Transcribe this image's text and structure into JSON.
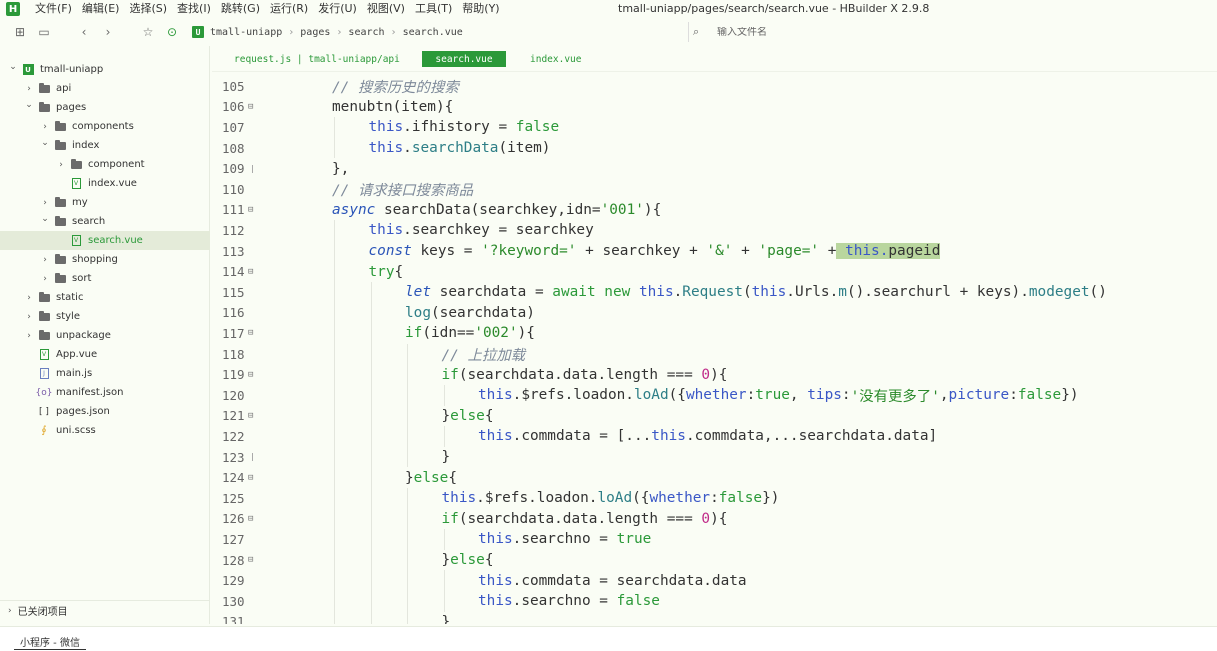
{
  "app": {
    "logo": "H",
    "window_title": "tmall-uniapp/pages/search/search.vue - HBuilder X 2.9.8",
    "menu": [
      "文件(F)",
      "编辑(E)",
      "选择(S)",
      "查找(I)",
      "跳转(G)",
      "运行(R)",
      "发行(U)",
      "视图(V)",
      "工具(T)",
      "帮助(Y)"
    ]
  },
  "toolbar": {
    "icons": [
      "new-file-icon",
      "save-icon",
      "back-icon",
      "forward-icon",
      "bookmark-star-icon",
      "run-icon"
    ],
    "glyphs": [
      "⊞",
      "▭",
      "‹",
      "›",
      "☆",
      "⊙"
    ],
    "project_badge": "U",
    "breadcrumb": [
      "tmall-uniapp",
      "pages",
      "search",
      "search.vue"
    ],
    "file_search_placeholder": "输入文件名",
    "file_search_glyph": "⌕"
  },
  "sidebar": {
    "tree": [
      {
        "label": "tmall-uniapp",
        "level": 0,
        "arrow": "⌄",
        "icon": "project"
      },
      {
        "label": "api",
        "level": 1,
        "arrow": "›",
        "icon": "folder"
      },
      {
        "label": "pages",
        "level": 1,
        "arrow": "⌄",
        "icon": "folder"
      },
      {
        "label": "components",
        "level": 2,
        "arrow": "›",
        "icon": "folder"
      },
      {
        "label": "index",
        "level": 2,
        "arrow": "⌄",
        "icon": "folder"
      },
      {
        "label": "component",
        "level": 3,
        "arrow": "›",
        "icon": "folder"
      },
      {
        "label": "index.vue",
        "level": 3,
        "arrow": "",
        "icon": "vue"
      },
      {
        "label": "my",
        "level": 2,
        "arrow": "›",
        "icon": "folder"
      },
      {
        "label": "search",
        "level": 2,
        "arrow": "⌄",
        "icon": "folder"
      },
      {
        "label": "search.vue",
        "level": 3,
        "arrow": "",
        "icon": "vue",
        "selected": true
      },
      {
        "label": "shopping",
        "level": 2,
        "arrow": "›",
        "icon": "folder"
      },
      {
        "label": "sort",
        "level": 2,
        "arrow": "›",
        "icon": "folder"
      },
      {
        "label": "static",
        "level": 1,
        "arrow": "›",
        "icon": "folder"
      },
      {
        "label": "style",
        "level": 1,
        "arrow": "›",
        "icon": "folder"
      },
      {
        "label": "unpackage",
        "level": 1,
        "arrow": "›",
        "icon": "folder"
      },
      {
        "label": "App.vue",
        "level": 1,
        "arrow": "",
        "icon": "vue"
      },
      {
        "label": "main.js",
        "level": 1,
        "arrow": "",
        "icon": "js"
      },
      {
        "label": "manifest.json",
        "level": 1,
        "arrow": "",
        "icon": "json"
      },
      {
        "label": "pages.json",
        "level": 1,
        "arrow": "",
        "icon": "brackets"
      },
      {
        "label": "uni.scss",
        "level": 1,
        "arrow": "",
        "icon": "scss"
      }
    ],
    "closed_projects": "已关闭项目"
  },
  "tabs": [
    {
      "label": "request.js | tmall-uniapp/api",
      "active": false
    },
    {
      "label": "search.vue",
      "active": true
    },
    {
      "label": "index.vue",
      "active": false
    }
  ],
  "editor": {
    "lines": [
      {
        "n": "105",
        "fold": "",
        "indent": 2,
        "tokens": [
          [
            "cm",
            "// 搜索历史的搜索"
          ]
        ]
      },
      {
        "n": "106",
        "fold": "box",
        "indent": 2,
        "tokens": [
          [
            "plain",
            "menubtn(item){"
          ]
        ]
      },
      {
        "n": "107",
        "fold": "",
        "indent": 3,
        "tokens": [
          [
            "this",
            "this"
          ],
          [
            "plain",
            ".ifhistory = "
          ],
          [
            "kw",
            "false"
          ]
        ]
      },
      {
        "n": "108",
        "fold": "",
        "indent": 3,
        "tokens": [
          [
            "this",
            "this"
          ],
          [
            "plain",
            "."
          ],
          [
            "fn",
            "searchData"
          ],
          [
            "plain",
            "(item)"
          ]
        ]
      },
      {
        "n": "109",
        "fold": "end",
        "indent": 2,
        "tokens": [
          [
            "plain",
            "},"
          ]
        ]
      },
      {
        "n": "110",
        "fold": "",
        "indent": 2,
        "tokens": [
          [
            "cm",
            "// 请求接口搜索商品"
          ]
        ]
      },
      {
        "n": "111",
        "fold": "box",
        "indent": 2,
        "tokens": [
          [
            "kwi",
            "async"
          ],
          [
            "plain",
            " searchData(searchkey,idn="
          ],
          [
            "str",
            "'001'"
          ],
          [
            "plain",
            "){"
          ]
        ]
      },
      {
        "n": "112",
        "fold": "",
        "indent": 3,
        "tokens": [
          [
            "this",
            "this"
          ],
          [
            "plain",
            ".searchkey = searchkey"
          ]
        ]
      },
      {
        "n": "113",
        "fold": "",
        "indent": 3,
        "tokens": [
          [
            "kwi",
            "const"
          ],
          [
            "plain",
            " keys = "
          ],
          [
            "str",
            "'?keyword='"
          ],
          [
            "plain",
            " + searchkey + "
          ],
          [
            "str",
            "'&'"
          ],
          [
            "plain",
            " + "
          ],
          [
            "str",
            "'page='"
          ],
          [
            "plain",
            " +"
          ],
          [
            "hlthis",
            " this."
          ],
          [
            "hlplain",
            "pageid"
          ]
        ]
      },
      {
        "n": "114",
        "fold": "box",
        "indent": 3,
        "tokens": [
          [
            "kw",
            "try"
          ],
          [
            "plain",
            "{"
          ]
        ]
      },
      {
        "n": "115",
        "fold": "",
        "indent": 4,
        "tokens": [
          [
            "kwi",
            "let"
          ],
          [
            "plain",
            " searchdata = "
          ],
          [
            "kw",
            "await"
          ],
          [
            "plain",
            " "
          ],
          [
            "kw",
            "new"
          ],
          [
            "plain",
            " "
          ],
          [
            "this",
            "this"
          ],
          [
            "plain",
            "."
          ],
          [
            "fn",
            "Request"
          ],
          [
            "plain",
            "("
          ],
          [
            "this",
            "this"
          ],
          [
            "plain",
            ".Urls."
          ],
          [
            "fn",
            "m"
          ],
          [
            "plain",
            "().searchurl + keys)."
          ],
          [
            "fn",
            "modeget"
          ],
          [
            "plain",
            "()"
          ]
        ]
      },
      {
        "n": "116",
        "fold": "",
        "indent": 4,
        "tokens": [
          [
            "fn",
            "log"
          ],
          [
            "plain",
            "(searchdata)"
          ]
        ]
      },
      {
        "n": "117",
        "fold": "box",
        "indent": 4,
        "tokens": [
          [
            "kw",
            "if"
          ],
          [
            "plain",
            "(idn=="
          ],
          [
            "str",
            "'002'"
          ],
          [
            "plain",
            "){"
          ]
        ]
      },
      {
        "n": "118",
        "fold": "",
        "indent": 5,
        "tokens": [
          [
            "cm",
            "// 上拉加载"
          ]
        ]
      },
      {
        "n": "119",
        "fold": "box",
        "indent": 5,
        "tokens": [
          [
            "kw",
            "if"
          ],
          [
            "plain",
            "(searchdata.data.length === "
          ],
          [
            "num",
            "0"
          ],
          [
            "plain",
            "){"
          ]
        ]
      },
      {
        "n": "120",
        "fold": "",
        "indent": 6,
        "tokens": [
          [
            "this",
            "this"
          ],
          [
            "plain",
            ".$refs.loadon."
          ],
          [
            "fn",
            "loAd"
          ],
          [
            "plain",
            "({"
          ],
          [
            "prop",
            "whether"
          ],
          [
            "plain",
            ":"
          ],
          [
            "kw",
            "true"
          ],
          [
            "plain",
            ", "
          ],
          [
            "prop",
            "tips"
          ],
          [
            "plain",
            ":"
          ],
          [
            "str",
            "'没有更多了'"
          ],
          [
            "plain",
            ","
          ],
          [
            "prop",
            "picture"
          ],
          [
            "plain",
            ":"
          ],
          [
            "kw",
            "false"
          ],
          [
            "plain",
            "})"
          ]
        ]
      },
      {
        "n": "121",
        "fold": "box",
        "indent": 5,
        "tokens": [
          [
            "plain",
            "}"
          ],
          [
            "kw",
            "else"
          ],
          [
            "plain",
            "{"
          ]
        ]
      },
      {
        "n": "122",
        "fold": "",
        "indent": 6,
        "tokens": [
          [
            "this",
            "this"
          ],
          [
            "plain",
            ".commdata = [..."
          ],
          [
            "this",
            "this"
          ],
          [
            "plain",
            ".commdata,...searchdata.data]"
          ]
        ]
      },
      {
        "n": "123",
        "fold": "end",
        "indent": 5,
        "tokens": [
          [
            "plain",
            "}"
          ]
        ]
      },
      {
        "n": "124",
        "fold": "box",
        "indent": 4,
        "tokens": [
          [
            "plain",
            "}"
          ],
          [
            "kw",
            "else"
          ],
          [
            "plain",
            "{"
          ]
        ]
      },
      {
        "n": "125",
        "fold": "",
        "indent": 5,
        "tokens": [
          [
            "this",
            "this"
          ],
          [
            "plain",
            ".$refs.loadon."
          ],
          [
            "fn",
            "loAd"
          ],
          [
            "plain",
            "({"
          ],
          [
            "prop",
            "whether"
          ],
          [
            "plain",
            ":"
          ],
          [
            "kw",
            "false"
          ],
          [
            "plain",
            "})"
          ]
        ]
      },
      {
        "n": "126",
        "fold": "box",
        "indent": 5,
        "tokens": [
          [
            "kw",
            "if"
          ],
          [
            "plain",
            "(searchdata.data.length === "
          ],
          [
            "num",
            "0"
          ],
          [
            "plain",
            "){"
          ]
        ]
      },
      {
        "n": "127",
        "fold": "",
        "indent": 6,
        "tokens": [
          [
            "this",
            "this"
          ],
          [
            "plain",
            ".searchno = "
          ],
          [
            "kw",
            "true"
          ]
        ]
      },
      {
        "n": "128",
        "fold": "box",
        "indent": 5,
        "tokens": [
          [
            "plain",
            "}"
          ],
          [
            "kw",
            "else"
          ],
          [
            "plain",
            "{"
          ]
        ]
      },
      {
        "n": "129",
        "fold": "",
        "indent": 6,
        "tokens": [
          [
            "this",
            "this"
          ],
          [
            "plain",
            ".commdata = searchdata.data"
          ]
        ]
      },
      {
        "n": "130",
        "fold": "",
        "indent": 6,
        "tokens": [
          [
            "this",
            "this"
          ],
          [
            "plain",
            ".searchno = "
          ],
          [
            "kw",
            "false"
          ]
        ]
      },
      {
        "n": "131",
        "fold": "",
        "indent": 5,
        "tokens": [
          [
            "plain",
            "}"
          ]
        ]
      }
    ]
  },
  "bottom": {
    "tab_label": "小程序 - 微信"
  },
  "colors": {
    "accent": "#2b9939",
    "background": "#fafdf5",
    "selection": "#e4ebd9",
    "highlight": "#b9d69e"
  }
}
